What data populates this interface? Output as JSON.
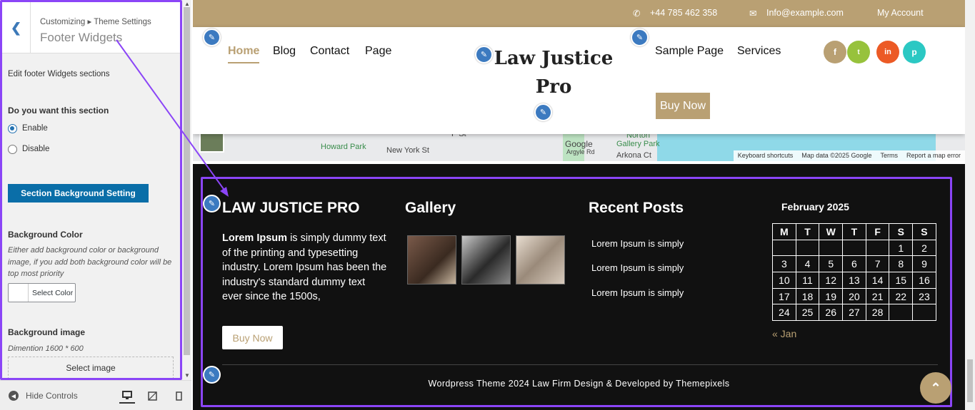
{
  "sidebar": {
    "breadcrumb": "Customizing ▸ Theme Settings",
    "title": "Footer Widgets",
    "description": "Edit footer Widgets sections",
    "section_question": "Do you want this section",
    "enable_label": "Enable",
    "disable_label": "Disable",
    "selected": "Enable",
    "section_bg_button": "Section Background Setting",
    "bg_color_label": "Background Color",
    "bg_color_help": "Either add background color or background image, if you add both background color will be top most priority",
    "select_color_label": "Select Color",
    "bg_image_label": "Background image",
    "bg_image_dim": "Dimention 1600 * 600",
    "select_image_label": "Select image",
    "hide_controls": "Hide Controls"
  },
  "topbar": {
    "phone": "+44 785 462 358",
    "email": "Info@example.com",
    "account": "My Account"
  },
  "nav": {
    "left_links": [
      "Home",
      "Blog",
      "Contact",
      "Page"
    ],
    "active": "Home",
    "site_title_line1": "Law Justice",
    "site_title_line2": "Pro",
    "right_links": [
      "Sample Page",
      "Services"
    ],
    "buy_button": "Buy Now",
    "social": [
      "f",
      "t",
      "in",
      "p"
    ]
  },
  "map": {
    "labels": [
      "Howard Park",
      "New York St",
      "P St",
      "Argyle Rd",
      "Norton",
      "Gallery Park",
      "Arkona Ct"
    ],
    "attribution": [
      "Keyboard shortcuts",
      "Map data ©2025 Google",
      "Terms",
      "Report a map error"
    ],
    "google": "Google"
  },
  "footer": {
    "col1_title": "LAW JUSTICE PRO",
    "col1_lead": "Lorem Ipsum",
    "col1_text": " is simply dummy text of the printing and typesetting industry. Lorem Ipsum has been the industry's standard dummy text ever since the 1500s,",
    "col1_button": "Buy Now",
    "col2_title": "Gallery",
    "col3_title": "Recent Posts",
    "posts": [
      "Lorem Ipsum is simply",
      "Lorem Ipsum is simply",
      "Lorem Ipsum is simply"
    ],
    "calendar": {
      "caption": "February 2025",
      "days": [
        "M",
        "T",
        "W",
        "T",
        "F",
        "S",
        "S"
      ],
      "weeks": [
        [
          "",
          "",
          "",
          "",
          "",
          "1",
          "2"
        ],
        [
          "3",
          "4",
          "5",
          "6",
          "7",
          "8",
          "9"
        ],
        [
          "10",
          "11",
          "12",
          "13",
          "14",
          "15",
          "16"
        ],
        [
          "17",
          "18",
          "19",
          "20",
          "21",
          "22",
          "23"
        ],
        [
          "24",
          "25",
          "26",
          "27",
          "28",
          "",
          ""
        ]
      ],
      "prev": "« Jan"
    },
    "copyright": "Wordpress Theme 2024 Law Firm Design & Developed by Themepixels"
  },
  "colors": {
    "accent": "#b9a073",
    "highlight_border": "#8b45f7",
    "customizer_button": "#0a6ea8",
    "edit_pencil": "#3c7ac0"
  }
}
